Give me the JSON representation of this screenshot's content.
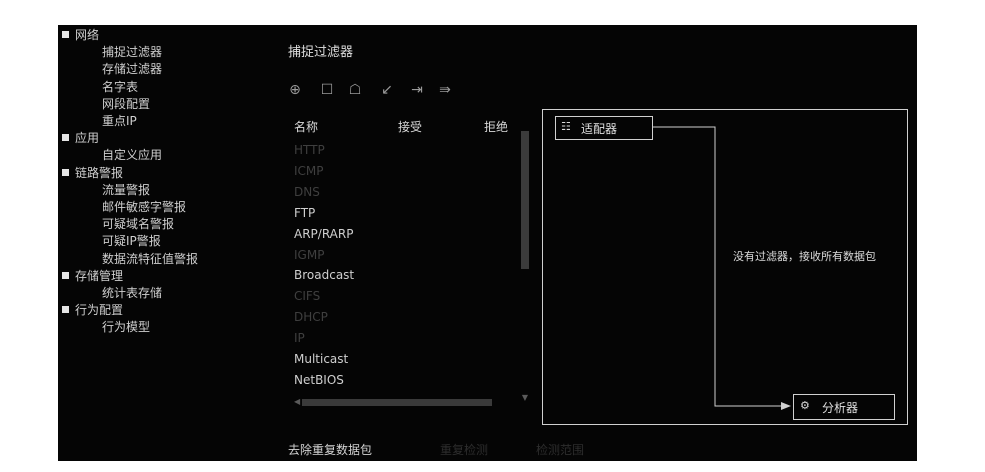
{
  "tree": [
    {
      "label": "网络",
      "children": [
        "捕捉过滤器",
        "存储过滤器",
        "名字表",
        "网段配置",
        "重点IP"
      ]
    },
    {
      "label": "应用",
      "children": [
        "自定义应用"
      ]
    },
    {
      "label": "链路警报",
      "children": [
        "流量警报",
        "邮件敏感字警报",
        "可疑域名警报",
        "可疑IP警报",
        "数据流特征值警报"
      ]
    },
    {
      "label": "存储管理",
      "children": [
        "统计表存储"
      ]
    },
    {
      "label": "行为配置",
      "children": [
        "行为模型"
      ]
    }
  ],
  "panel": {
    "title": "捕捉过滤器",
    "toolbar": [
      "add-icon",
      "edit-icon",
      "delete-icon",
      "undo-icon",
      "import-icon",
      "export-icon"
    ],
    "columns": {
      "name": "名称",
      "accept": "接受",
      "reject": "拒绝"
    },
    "protocols": [
      {
        "name": "HTTP",
        "enabled": false
      },
      {
        "name": "ICMP",
        "enabled": false
      },
      {
        "name": "DNS",
        "enabled": false
      },
      {
        "name": "FTP",
        "enabled": true
      },
      {
        "name": "ARP/RARP",
        "enabled": true
      },
      {
        "name": "IGMP",
        "enabled": false
      },
      {
        "name": "Broadcast",
        "enabled": true
      },
      {
        "name": "CIFS",
        "enabled": false
      },
      {
        "name": "DHCP",
        "enabled": false
      },
      {
        "name": "IP",
        "enabled": false
      },
      {
        "name": "Multicast",
        "enabled": true
      },
      {
        "name": "NetBIOS",
        "enabled": true
      }
    ],
    "dedup_label": "去除重复数据包",
    "option_a": "重复检测",
    "option_b": "检测范围"
  },
  "diagram": {
    "adapter": "适配器",
    "no_filter_text": "没有过滤器，接收所有数据包",
    "analyzer": "分析器"
  }
}
